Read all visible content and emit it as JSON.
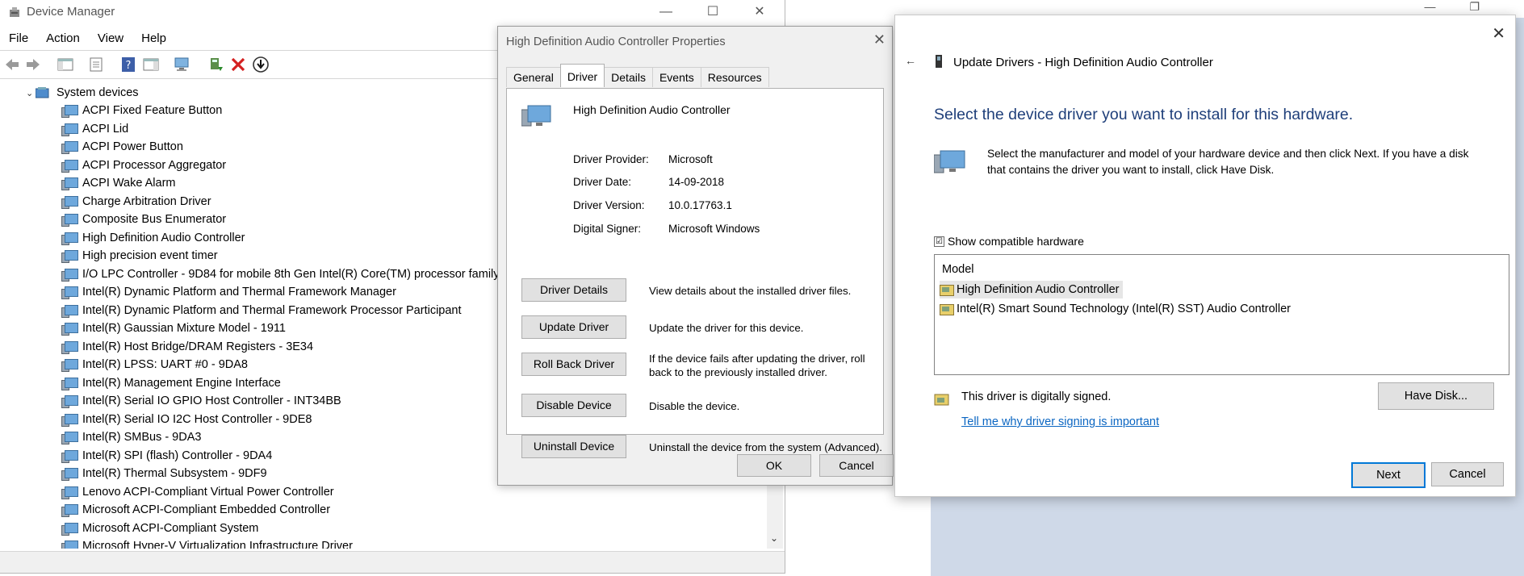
{
  "device_manager": {
    "title": "Device Manager",
    "menu": [
      "File",
      "Action",
      "View",
      "Help"
    ],
    "tree_root": "System devices",
    "tree_items": [
      "ACPI Fixed Feature Button",
      "ACPI Lid",
      "ACPI Power Button",
      "ACPI Processor Aggregator",
      "ACPI Wake Alarm",
      "Charge Arbitration Driver",
      "Composite Bus Enumerator",
      "High Definition Audio Controller",
      "High precision event timer",
      "I/O LPC Controller - 9D84 for mobile 8th Gen Intel(R) Core(TM) processor family",
      "Intel(R) Dynamic Platform and Thermal Framework Manager",
      "Intel(R) Dynamic Platform and Thermal Framework Processor Participant",
      "Intel(R) Gaussian Mixture Model - 1911",
      "Intel(R) Host Bridge/DRAM Registers - 3E34",
      "Intel(R) LPSS: UART #0 - 9DA8",
      "Intel(R) Management Engine Interface",
      "Intel(R) Serial IO GPIO Host Controller - INT34BB",
      "Intel(R) Serial IO I2C Host Controller - 9DE8",
      "Intel(R) SMBus - 9DA3",
      "Intel(R) SPI (flash) Controller - 9DA4",
      "Intel(R) Thermal Subsystem - 9DF9",
      "Lenovo ACPI-Compliant Virtual Power Controller",
      "Microsoft ACPI-Compliant Embedded Controller",
      "Microsoft ACPI-Compliant System",
      "Microsoft Hyper-V Virtualization Infrastructure Driver"
    ]
  },
  "properties": {
    "title": "High Definition Audio Controller Properties",
    "tabs": [
      "General",
      "Driver",
      "Details",
      "Events",
      "Resources"
    ],
    "active_tab": "Driver",
    "device_name": "High Definition Audio Controller",
    "fields": [
      {
        "key": "Driver Provider:",
        "value": "Microsoft"
      },
      {
        "key": "Driver Date:",
        "value": "14-09-2018"
      },
      {
        "key": "Driver Version:",
        "value": "10.0.17763.1"
      },
      {
        "key": "Digital Signer:",
        "value": "Microsoft Windows"
      }
    ],
    "actions": [
      {
        "label": "Driver Details",
        "desc": "View details about the installed driver files."
      },
      {
        "label": "Update Driver",
        "desc": "Update the driver for this device."
      },
      {
        "label": "Roll Back Driver",
        "desc": "If the device fails after updating the driver, roll back to the previously installed driver."
      },
      {
        "label": "Disable Device",
        "desc": "Disable the device."
      },
      {
        "label": "Uninstall Device",
        "desc": "Uninstall the device from the system (Advanced)."
      }
    ],
    "ok_label": "OK",
    "cancel_label": "Cancel"
  },
  "update_drivers": {
    "header": "Update Drivers - High Definition Audio Controller",
    "heading": "Select the device driver you want to install for this hardware.",
    "instruction": "Select the manufacturer and model of your hardware device and then click Next. If you have a disk that contains the driver you want to install, click Have Disk.",
    "show_compatible_label": "Show compatible hardware",
    "show_compatible_checked": true,
    "check_mark": "☑",
    "model_header": "Model",
    "models": [
      "High Definition Audio Controller",
      "Intel(R) Smart Sound Technology (Intel(R) SST) Audio Controller"
    ],
    "selected_model_index": 0,
    "signed_text": "This driver is digitally signed.",
    "signing_link": "Tell me why driver signing is important",
    "have_disk_label": "Have Disk...",
    "next_label": "Next",
    "cancel_label": "Cancel"
  },
  "colors": {
    "heading_blue": "#1f3f7a",
    "link_blue": "#0b66c2",
    "desktop_bg": "#cfd9e8"
  }
}
